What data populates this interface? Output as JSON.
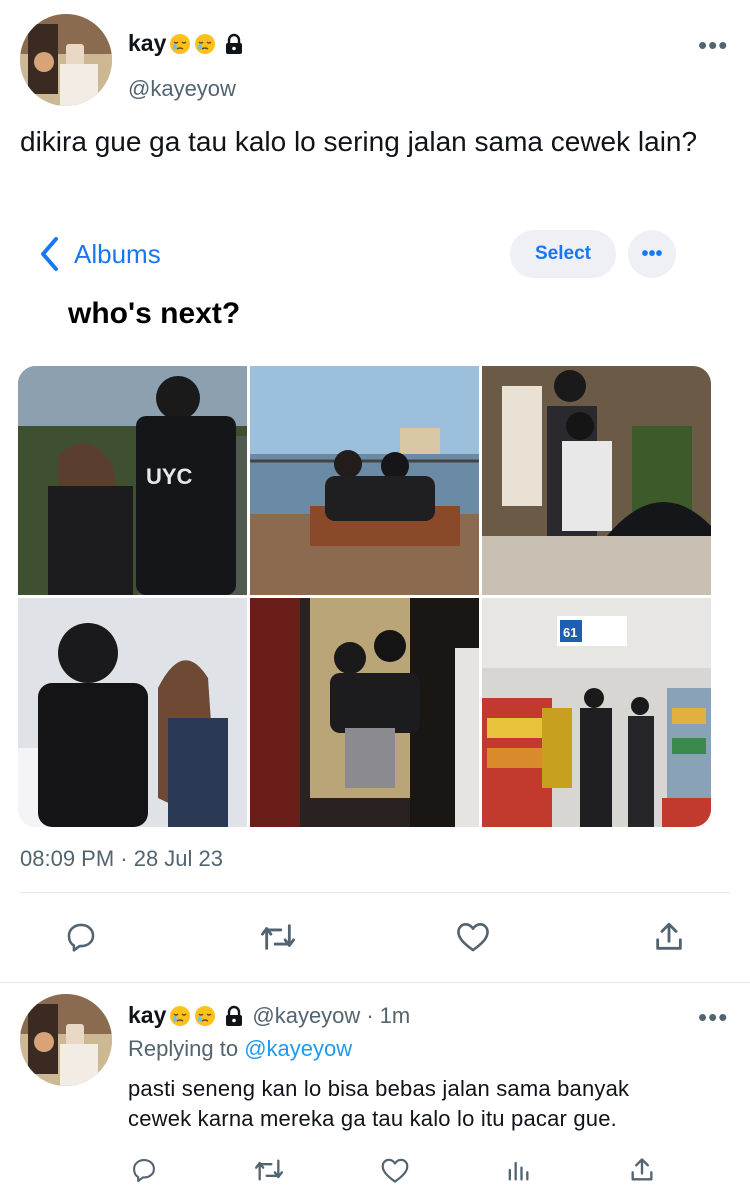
{
  "tweet": {
    "display_name": "kay",
    "handle": "@kayeyow",
    "text": "dikira gue ga tau kalo lo sering jalan sama cewek lain?",
    "timestamp": "08:09 PM · 28 Jul 23",
    "more_label": "•••"
  },
  "embed": {
    "back_label": "Albums",
    "select_label": "Select",
    "more_label": "•••",
    "headline": "who's next?",
    "photos": [
      "couple-night-street",
      "couple-bench-waterfront",
      "couple-umbrella-outdoor",
      "couple-office",
      "couple-cafe",
      "couple-supermarket"
    ],
    "store_sign_number": "61"
  },
  "reply": {
    "display_name": "kay",
    "handle": "@kayeyow",
    "separator": "·",
    "time": "1m",
    "replying_prefix": "Replying to",
    "replying_handle": "@kayeyow",
    "text_line1": "pasti seneng kan lo bisa bebas jalan sama banyak",
    "text_line2": "cewek karna mereka ga tau kalo lo itu pacar gue.",
    "more_label": "•••"
  },
  "icons": [
    "reply-icon",
    "retweet-icon",
    "like-icon",
    "share-icon",
    "views-icon",
    "lock-icon",
    "sleepy-face-emoji"
  ],
  "colors": {
    "link": "#1d9bf0",
    "secondary": "#536471",
    "album_blue": "#1877f2"
  }
}
